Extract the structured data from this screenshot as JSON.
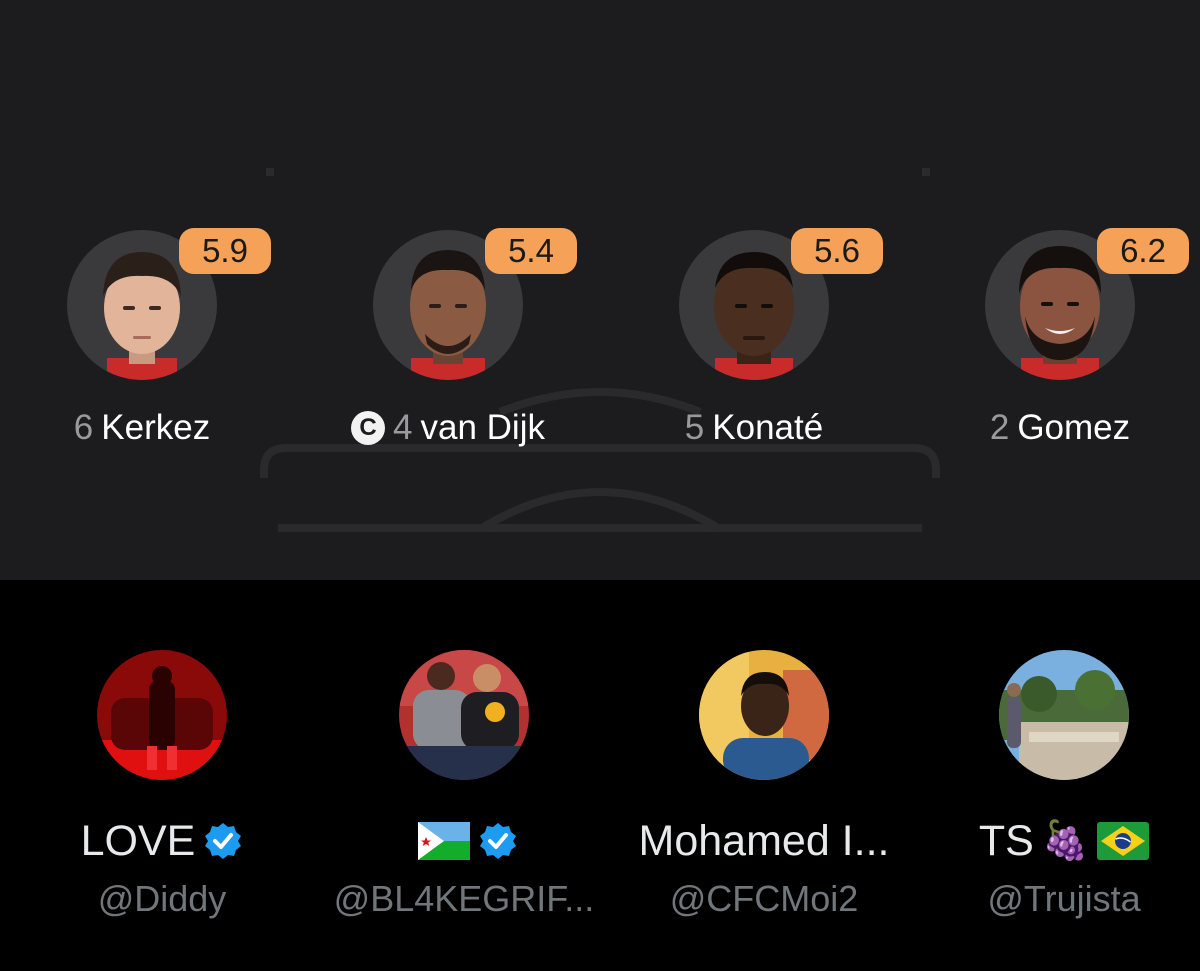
{
  "lineup": {
    "players": [
      {
        "number": "6",
        "name": "Kerkez",
        "rating": "5.9",
        "captain": false
      },
      {
        "number": "4",
        "name": "van Dijk",
        "rating": "5.4",
        "captain": true
      },
      {
        "number": "5",
        "name": "Konaté",
        "rating": "5.6",
        "captain": false
      },
      {
        "number": "2",
        "name": "Gomez",
        "rating": "6.2",
        "captain": false
      }
    ],
    "captain_label": "C",
    "rating_color": "#f5a158"
  },
  "accounts": [
    {
      "name": "LOVE",
      "verified": true,
      "handle": "@Diddy"
    },
    {
      "name": "",
      "flag": "djibouti-flag-icon",
      "verified": true,
      "handle": "@BL4KEGRIF..."
    },
    {
      "name": "Mohamed I...",
      "verified": false,
      "handle": "@CFCMoi2"
    },
    {
      "name": "TS",
      "emoji": "🍇",
      "flag": "brazil-flag-icon",
      "verified": false,
      "handle": "@Trujista"
    }
  ],
  "colors": {
    "verified_blue": "#1d9bf0",
    "panel_bg": "#1c1c1e"
  }
}
